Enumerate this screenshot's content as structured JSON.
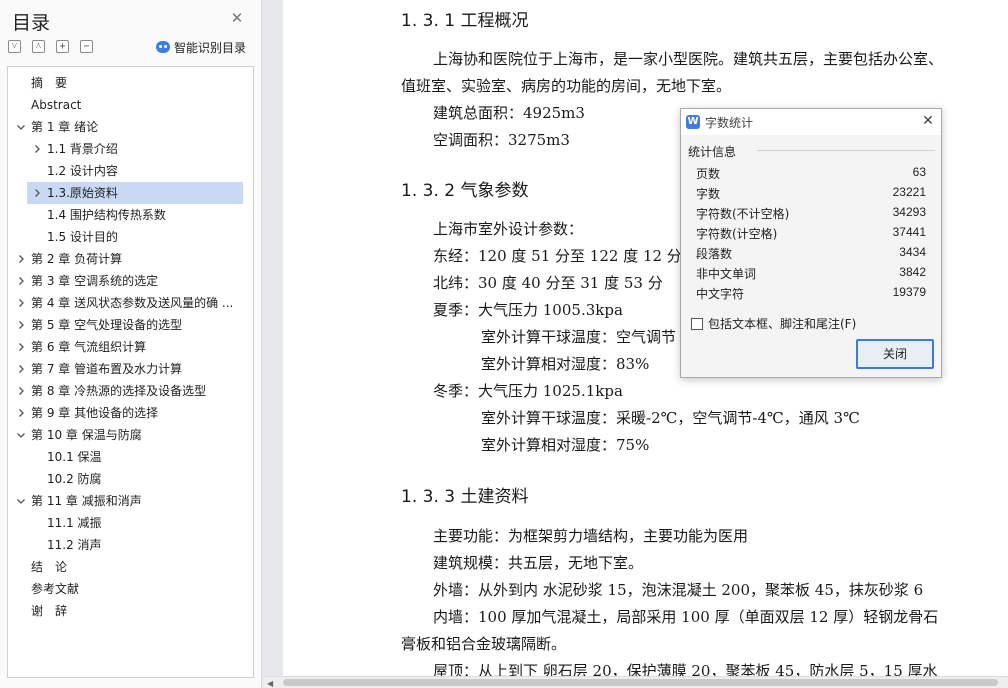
{
  "sidebar": {
    "title": "目录",
    "smart_toc_label": "智能识别目录",
    "items": [
      {
        "label": "摘　要",
        "level": 0,
        "chevron": "none"
      },
      {
        "label": "Abstract",
        "level": 0,
        "chevron": "none"
      },
      {
        "label": "第 1 章 绪论",
        "level": 0,
        "chevron": "down"
      },
      {
        "label": "1.1 背景介绍",
        "level": 1,
        "chevron": "right"
      },
      {
        "label": "1.2 设计内容",
        "level": 1,
        "chevron": "none"
      },
      {
        "label": "1.3.原始资料",
        "level": 1,
        "chevron": "right",
        "selected": true
      },
      {
        "label": "1.4 围护结构传热系数",
        "level": 1,
        "chevron": "none"
      },
      {
        "label": "1.5 设计目的",
        "level": 1,
        "chevron": "none"
      },
      {
        "label": "第 2 章 负荷计算",
        "level": 0,
        "chevron": "right"
      },
      {
        "label": "第 3 章 空调系统的选定",
        "level": 0,
        "chevron": "right"
      },
      {
        "label": "第 4 章 送风状态参数及送风量的确 ...",
        "level": 0,
        "chevron": "right"
      },
      {
        "label": "第 5 章 空气处理设备的选型",
        "level": 0,
        "chevron": "right"
      },
      {
        "label": "第 6 章 气流组织计算",
        "level": 0,
        "chevron": "right"
      },
      {
        "label": "第 7 章 管道布置及水力计算",
        "level": 0,
        "chevron": "right"
      },
      {
        "label": "第 8 章 冷热源的选择及设备选型",
        "level": 0,
        "chevron": "right"
      },
      {
        "label": "第 9 章 其他设备的选择",
        "level": 0,
        "chevron": "right"
      },
      {
        "label": "第 10 章 保温与防腐",
        "level": 0,
        "chevron": "down"
      },
      {
        "label": "10.1 保温",
        "level": 1,
        "chevron": "none"
      },
      {
        "label": "10.2 防腐",
        "level": 1,
        "chevron": "none"
      },
      {
        "label": "第 11 章 减振和消声",
        "level": 0,
        "chevron": "down"
      },
      {
        "label": "11.1 减振",
        "level": 1,
        "chevron": "none"
      },
      {
        "label": "11.2 消声",
        "level": 1,
        "chevron": "none"
      },
      {
        "label": "结　论",
        "level": 0,
        "chevron": "none"
      },
      {
        "label": "参考文献",
        "level": 0,
        "chevron": "none"
      },
      {
        "label": "谢　辞",
        "level": 0,
        "chevron": "none"
      }
    ]
  },
  "document": {
    "sec1_heading": "1. 3. 1  工程概况",
    "sec1_p1a": "上海协和医院位于上海市，是一家小型医院。建筑共五层，主要包括办公室、",
    "sec1_p1b": "值班室、实验室、病房的功能的房间，无地下室。",
    "sec1_area": "建筑总面积：4925m3",
    "sec1_ac_area": "空调面积：3275m3",
    "sec2_heading": "1. 3. 2  气象参数",
    "sec2_intro": "上海市室外设计参数：",
    "sec2_lon": "东经：120 度 51 分至 122 度 12 分",
    "sec2_lat": "北纬：30 度 40 分至 31 度 53 分",
    "sec2_summer": "夏季：大气压力 1005.3kpa",
    "sec2_summer_t": "室外计算干球温度：空气调节",
    "sec2_summer_rh": "室外计算相对湿度：83%",
    "sec2_winter": "冬季：大气压力 1025.1kpa",
    "sec2_winter_t": "室外计算干球温度：采暖-2℃，空气调节-4℃，通风 3℃",
    "sec2_winter_rh": "室外计算相对湿度：75%",
    "sec3_heading": "1. 3. 3  土建资料",
    "sec3_func": "主要功能：为框架剪力墙结构，主要功能为医用",
    "sec3_scale": "建筑规模：共五层，无地下室。",
    "sec3_outer": "外墙：从外到内  水泥砂浆 15，泡沫混凝土 200，聚苯板 45，抹灰砂浆 6",
    "sec3_inner_a": "内墙：100 厚加气混凝土，局部采用 100 厚（单面双层 12 厚）轻钢龙骨石",
    "sec3_inner_b": "膏板和铝合金玻璃隔断。",
    "sec3_roof": "屋顶：从上到下  卵石层 20，保护薄膜 20，聚苯板 45，防水层 5，15 厚水"
  },
  "dialog": {
    "title": "字数统计",
    "section": "统计信息",
    "stats": [
      {
        "label": "页数",
        "value": "63"
      },
      {
        "label": "字数",
        "value": "23221"
      },
      {
        "label": "字符数(不计空格)",
        "value": "34293"
      },
      {
        "label": "字符数(计空格)",
        "value": "37441"
      },
      {
        "label": "段落数",
        "value": "3434"
      },
      {
        "label": "非中文单词",
        "value": "3842"
      },
      {
        "label": "中文字符",
        "value": "19379"
      }
    ],
    "checkbox_label": "包括文本框、脚注和尾注(F)",
    "checkbox_checked": false,
    "close_button": "关闭"
  },
  "colors": {
    "selection": "#c7d9f3",
    "accent": "#3d7ad6"
  }
}
